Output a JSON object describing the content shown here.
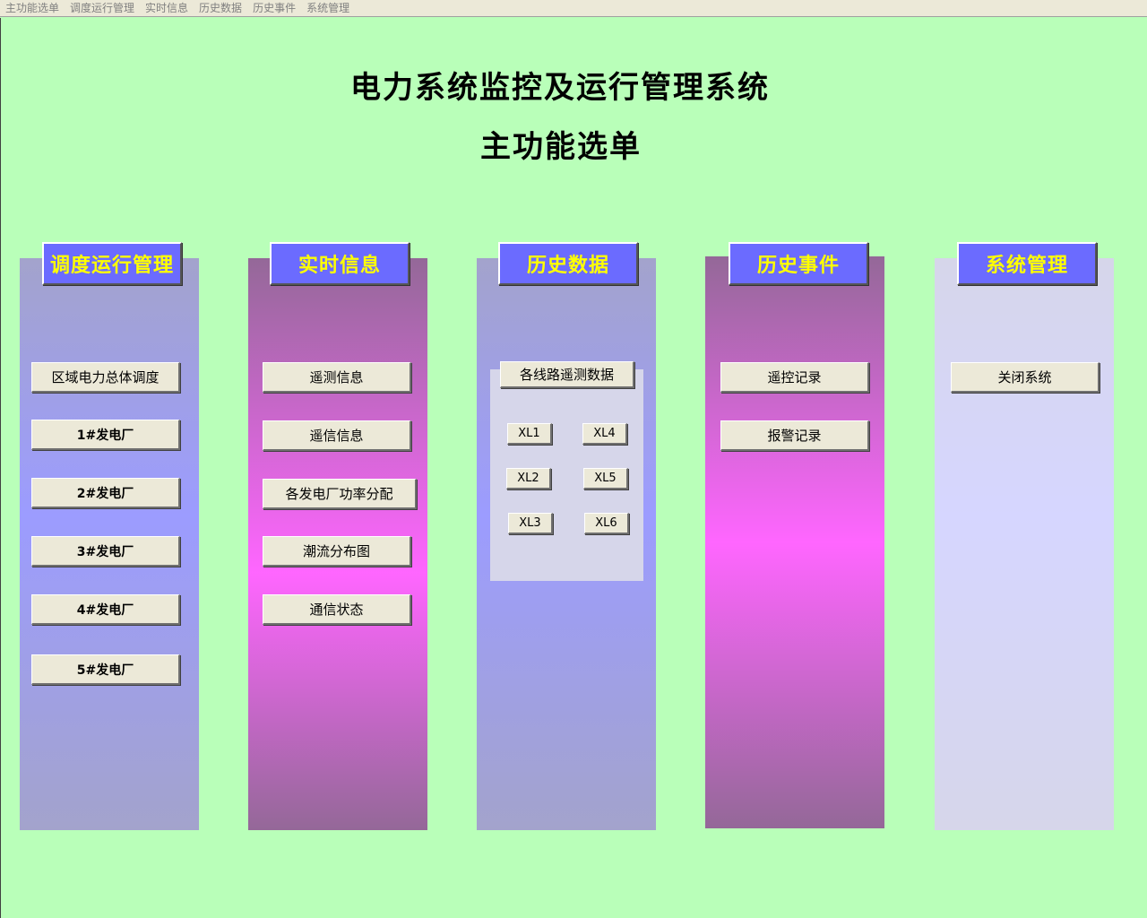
{
  "menu": [
    "主功能选单",
    "调度运行管理",
    "实时信息",
    "历史数据",
    "历史事件",
    "系统管理"
  ],
  "title": "电力系统监控及运行管理系统",
  "subtitle": "主功能选单",
  "columns": {
    "dispatch": {
      "header": "调度运行管理",
      "buttons": [
        "区域电力总体调度",
        "1#发电厂",
        "2#发电厂",
        "3#发电厂",
        "4#发电厂",
        "5#发电厂"
      ]
    },
    "realtime": {
      "header": "实时信息",
      "buttons": [
        "遥测信息",
        "遥信信息",
        "各发电厂功率分配",
        "潮流分布图",
        "通信状态"
      ]
    },
    "history_data": {
      "header": "历史数据",
      "main_button": "各线路遥测数据",
      "lines": [
        "XL1",
        "XL4",
        "XL2",
        "XL5",
        "XL3",
        "XL6"
      ]
    },
    "history_events": {
      "header": "历史事件",
      "buttons": [
        "遥控记录",
        "报警记录"
      ]
    },
    "system": {
      "header": "系统管理",
      "buttons": [
        "关闭系统"
      ]
    }
  },
  "colors": {
    "background": "#b9ffb9",
    "header_bg": "#6b6bff",
    "header_text": "#ffff00",
    "button_bg": "#ece9d8"
  }
}
